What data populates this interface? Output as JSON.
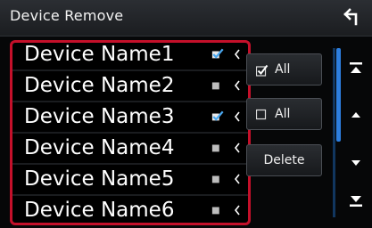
{
  "header": {
    "title": "Device Remove"
  },
  "devices": [
    {
      "name": "Device Name1",
      "checked": true
    },
    {
      "name": "Device Name2",
      "checked": false
    },
    {
      "name": "Device Name3",
      "checked": true
    },
    {
      "name": "Device Name4",
      "checked": false
    },
    {
      "name": "Device Name5",
      "checked": false
    },
    {
      "name": "Device Name6",
      "checked": false
    }
  ],
  "actions": {
    "select_all_label": "All",
    "deselect_all_label": "All",
    "delete_label": "Delete"
  },
  "scroll": {
    "start_fraction": 0.0,
    "visible_fraction": 0.55
  },
  "colors": {
    "highlight_frame": "#c4102a",
    "check_blue": "#4aa8f0",
    "scroll_blue": "#2d7fe0"
  },
  "icons": {
    "back": "back-arrow-icon",
    "row_check": "checkbox-icon",
    "row_arrow": "chevron-left-icon",
    "scroll_top": "scroll-to-top-icon",
    "scroll_up": "scroll-up-icon",
    "scroll_down": "scroll-down-icon",
    "scroll_bottom": "scroll-to-bottom-icon"
  }
}
